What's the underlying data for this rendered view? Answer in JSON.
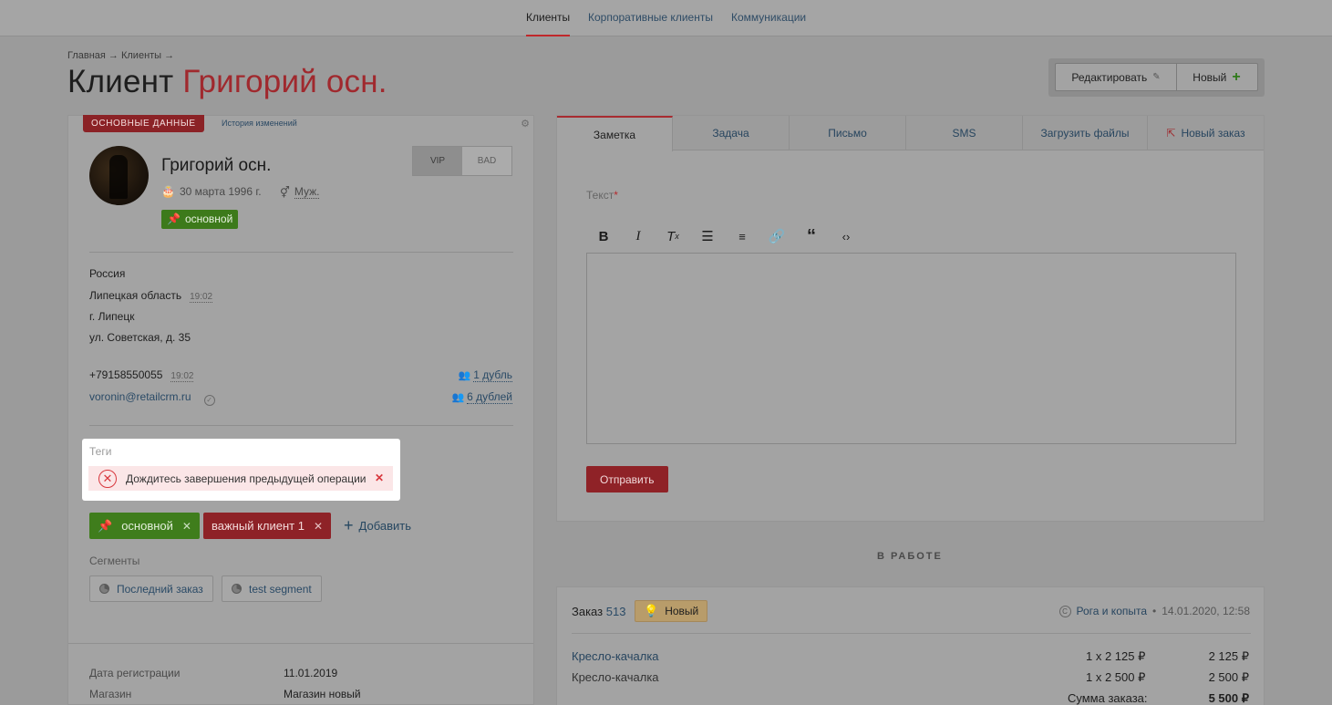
{
  "topnav": {
    "tabs": [
      {
        "label": "Клиенты",
        "active": true
      },
      {
        "label": "Корпоративные клиенты",
        "active": false
      },
      {
        "label": "Коммуникации",
        "active": false
      }
    ]
  },
  "breadcrumb": "Главная → Клиенты →",
  "title": {
    "prefix": "Клиент",
    "name": "Григорий осн."
  },
  "head_actions": {
    "edit": "Редактировать",
    "new": "Новый"
  },
  "client": {
    "section_badge": "ОСНОВНЫЕ ДАННЫЕ",
    "history_link": "История изменений",
    "name": "Григорий осн.",
    "vip": "VIP",
    "bad": "BAD",
    "birthday": "30 марта 1996 г.",
    "sex": "Муж.",
    "main_tag": "основной",
    "address": {
      "country": "Россия",
      "region": "Липецкая область",
      "region_time": "19:02",
      "city": "г. Липецк",
      "street": "ул. Советская, д. 35"
    },
    "phone": "+79158550055",
    "phone_time": "19:02",
    "phone_dups": "1 дубль",
    "email": "voronin@retailcrm.ru",
    "email_dups": "6 дублей",
    "tags_label": "Теги",
    "error_text": "Дождитесь завершения предыдущей операции",
    "tags": [
      "основной",
      "важный клиент 1"
    ],
    "add_tag": "Добавить",
    "segments_label": "Сегменты",
    "segments": [
      "Последний заказ",
      "test segment"
    ],
    "reg_label": "Дата регистрации",
    "reg_value": "11.01.2019",
    "shop_label": "Магазин",
    "shop_value": "Магазин новый"
  },
  "composer": {
    "tabs": [
      "Заметка",
      "Задача",
      "Письмо",
      "SMS",
      "Загрузить файлы",
      "Новый заказ"
    ],
    "text_label": "Текст",
    "required_mark": "*",
    "send": "Отправить"
  },
  "in_work": "В РАБОТЕ",
  "order": {
    "label": "Заказ",
    "number": "513",
    "status": "Новый",
    "shop": "Рога и копыта",
    "sep": "•",
    "date": "14.01.2020, 12:58",
    "items": [
      {
        "name": "Кресло-качалка",
        "qty": "1 x 2 125 ₽",
        "sum": "2 125 ₽",
        "link": true
      },
      {
        "name": "Кресло-качалка",
        "qty": "1 x 2 500 ₽",
        "sum": "2 500 ₽",
        "link": false
      }
    ],
    "total_label": "Сумма заказа:",
    "total": "5 500 ₽"
  }
}
